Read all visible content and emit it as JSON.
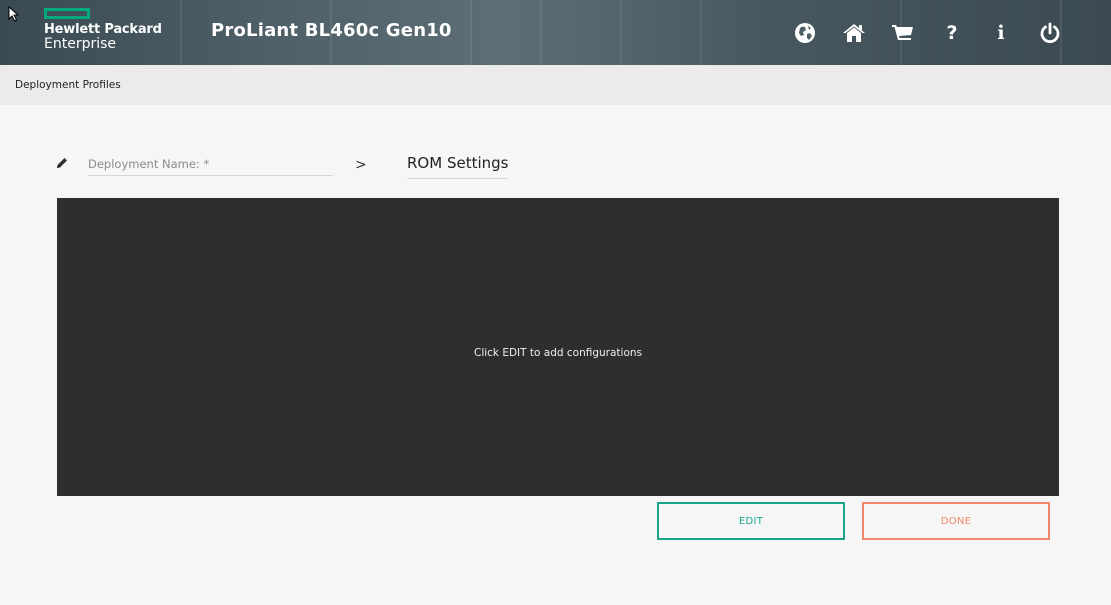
{
  "header": {
    "logo_line1": "Hewlett Packard",
    "logo_line2": "Enterprise",
    "product_title": "ProLiant BL460c Gen10",
    "icons": [
      "globe-icon",
      "home-icon",
      "cart-icon",
      "help-icon",
      "info-icon",
      "power-icon"
    ],
    "help_glyph": "?",
    "info_glyph": "i"
  },
  "breadcrumb": {
    "label": "Deployment Profiles"
  },
  "deployment": {
    "name_placeholder": "Deployment Name: *",
    "name_value": "",
    "separator": ">",
    "active_tab": "ROM Settings"
  },
  "config_panel": {
    "empty_message": "Click EDIT to add configurations"
  },
  "actions": {
    "edit_label": "EDIT",
    "done_label": "DONE"
  },
  "colors": {
    "brand_green": "#01a982",
    "edit_accent": "#18a58a",
    "done_accent": "#f0886a",
    "panel_bg": "#2e2e2e"
  }
}
